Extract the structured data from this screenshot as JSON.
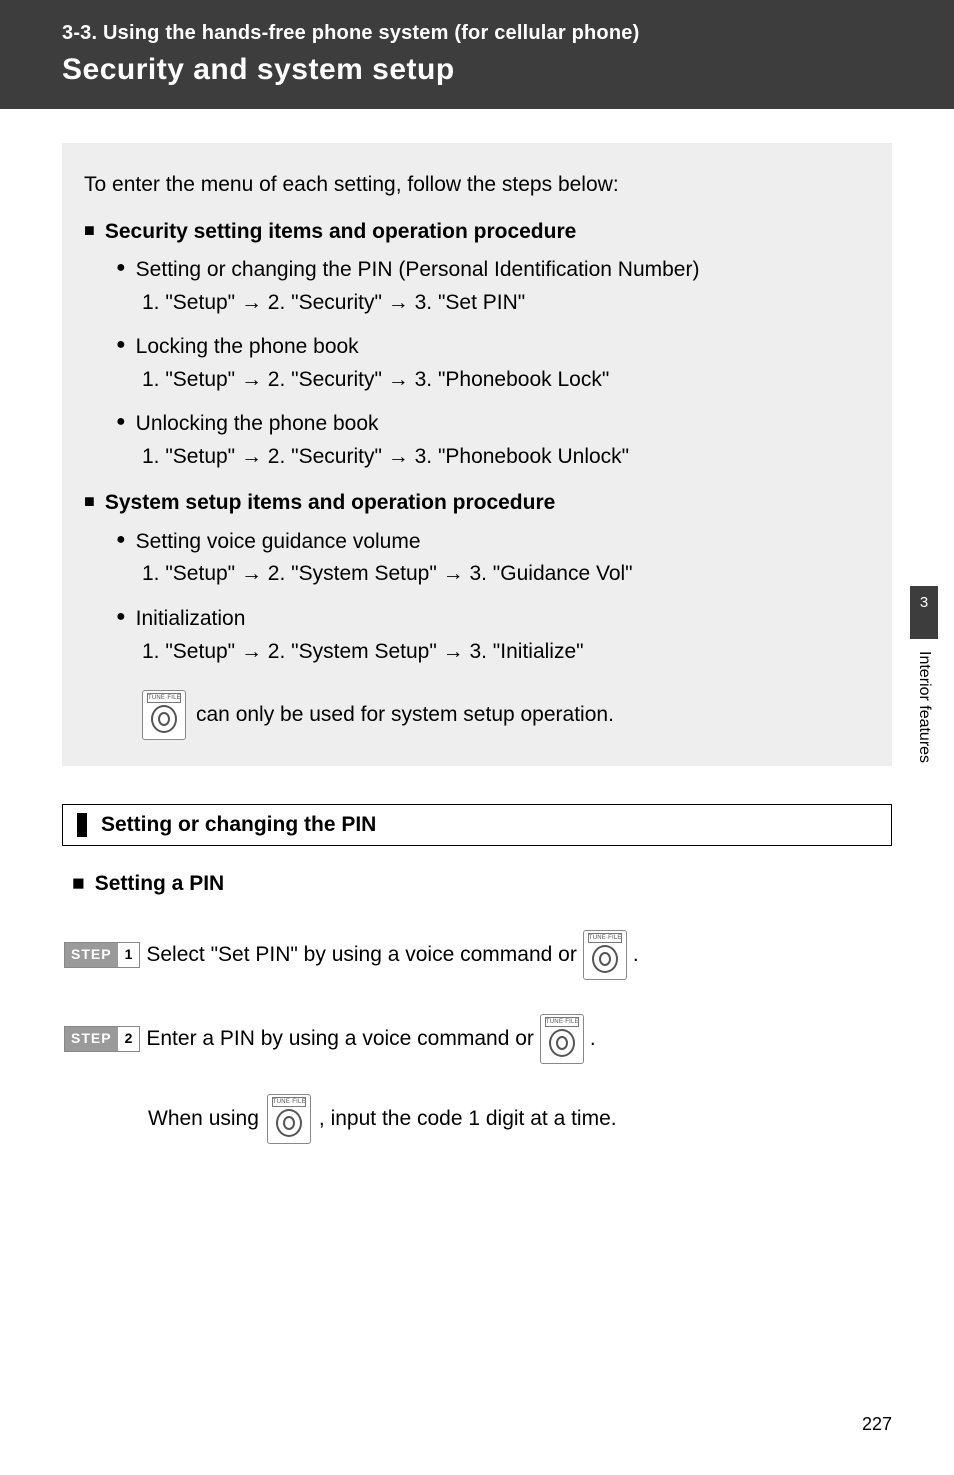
{
  "header": {
    "section_number_title": "3-3. Using the hands-free phone system (for cellular phone)",
    "page_title": "Security and system setup"
  },
  "intro": "To enter the menu of each setting, follow the steps below:",
  "groups": [
    {
      "heading": "Security setting items and operation procedure",
      "items": [
        {
          "label": "Setting or changing the PIN (Personal Identification Number)",
          "path": "1. \"Setup\" → 2. \"Security\" → 3. \"Set PIN\""
        },
        {
          "label": "Locking the phone book",
          "path": "1. \"Setup\" → 2. \"Security\" → 3. \"Phonebook Lock\""
        },
        {
          "label": "Unlocking the phone book",
          "path": "1. \"Setup\" → 2. \"Security\" → 3. \"Phonebook Unlock\""
        }
      ]
    },
    {
      "heading": "System setup items and operation procedure",
      "items": [
        {
          "label": "Setting voice guidance volume",
          "path": "1. \"Setup\" → 2. \"System Setup\" → 3. \"Guidance Vol\""
        },
        {
          "label": "Initialization",
          "path": "1. \"Setup\" → 2. \"System Setup\" → 3. \"Initialize\""
        }
      ]
    }
  ],
  "knob_note": " can only be used for system setup operation.",
  "section_title": "Setting or changing the PIN",
  "sub_heading": "Setting a PIN",
  "steps": [
    {
      "num": "1",
      "text_before": "Select \"Set PIN\" by using a voice command or ",
      "text_after": " ."
    },
    {
      "num": "2",
      "text_before": "Enter a PIN by using a voice command or ",
      "text_after": " ."
    }
  ],
  "indent_note_before": "When using ",
  "indent_note_after": " , input the code 1 digit at a time.",
  "side": {
    "chapter": "3",
    "label": "Interior features"
  },
  "page_number": "227",
  "step_label": "STEP",
  "knob_label": "TUNE·FILE"
}
